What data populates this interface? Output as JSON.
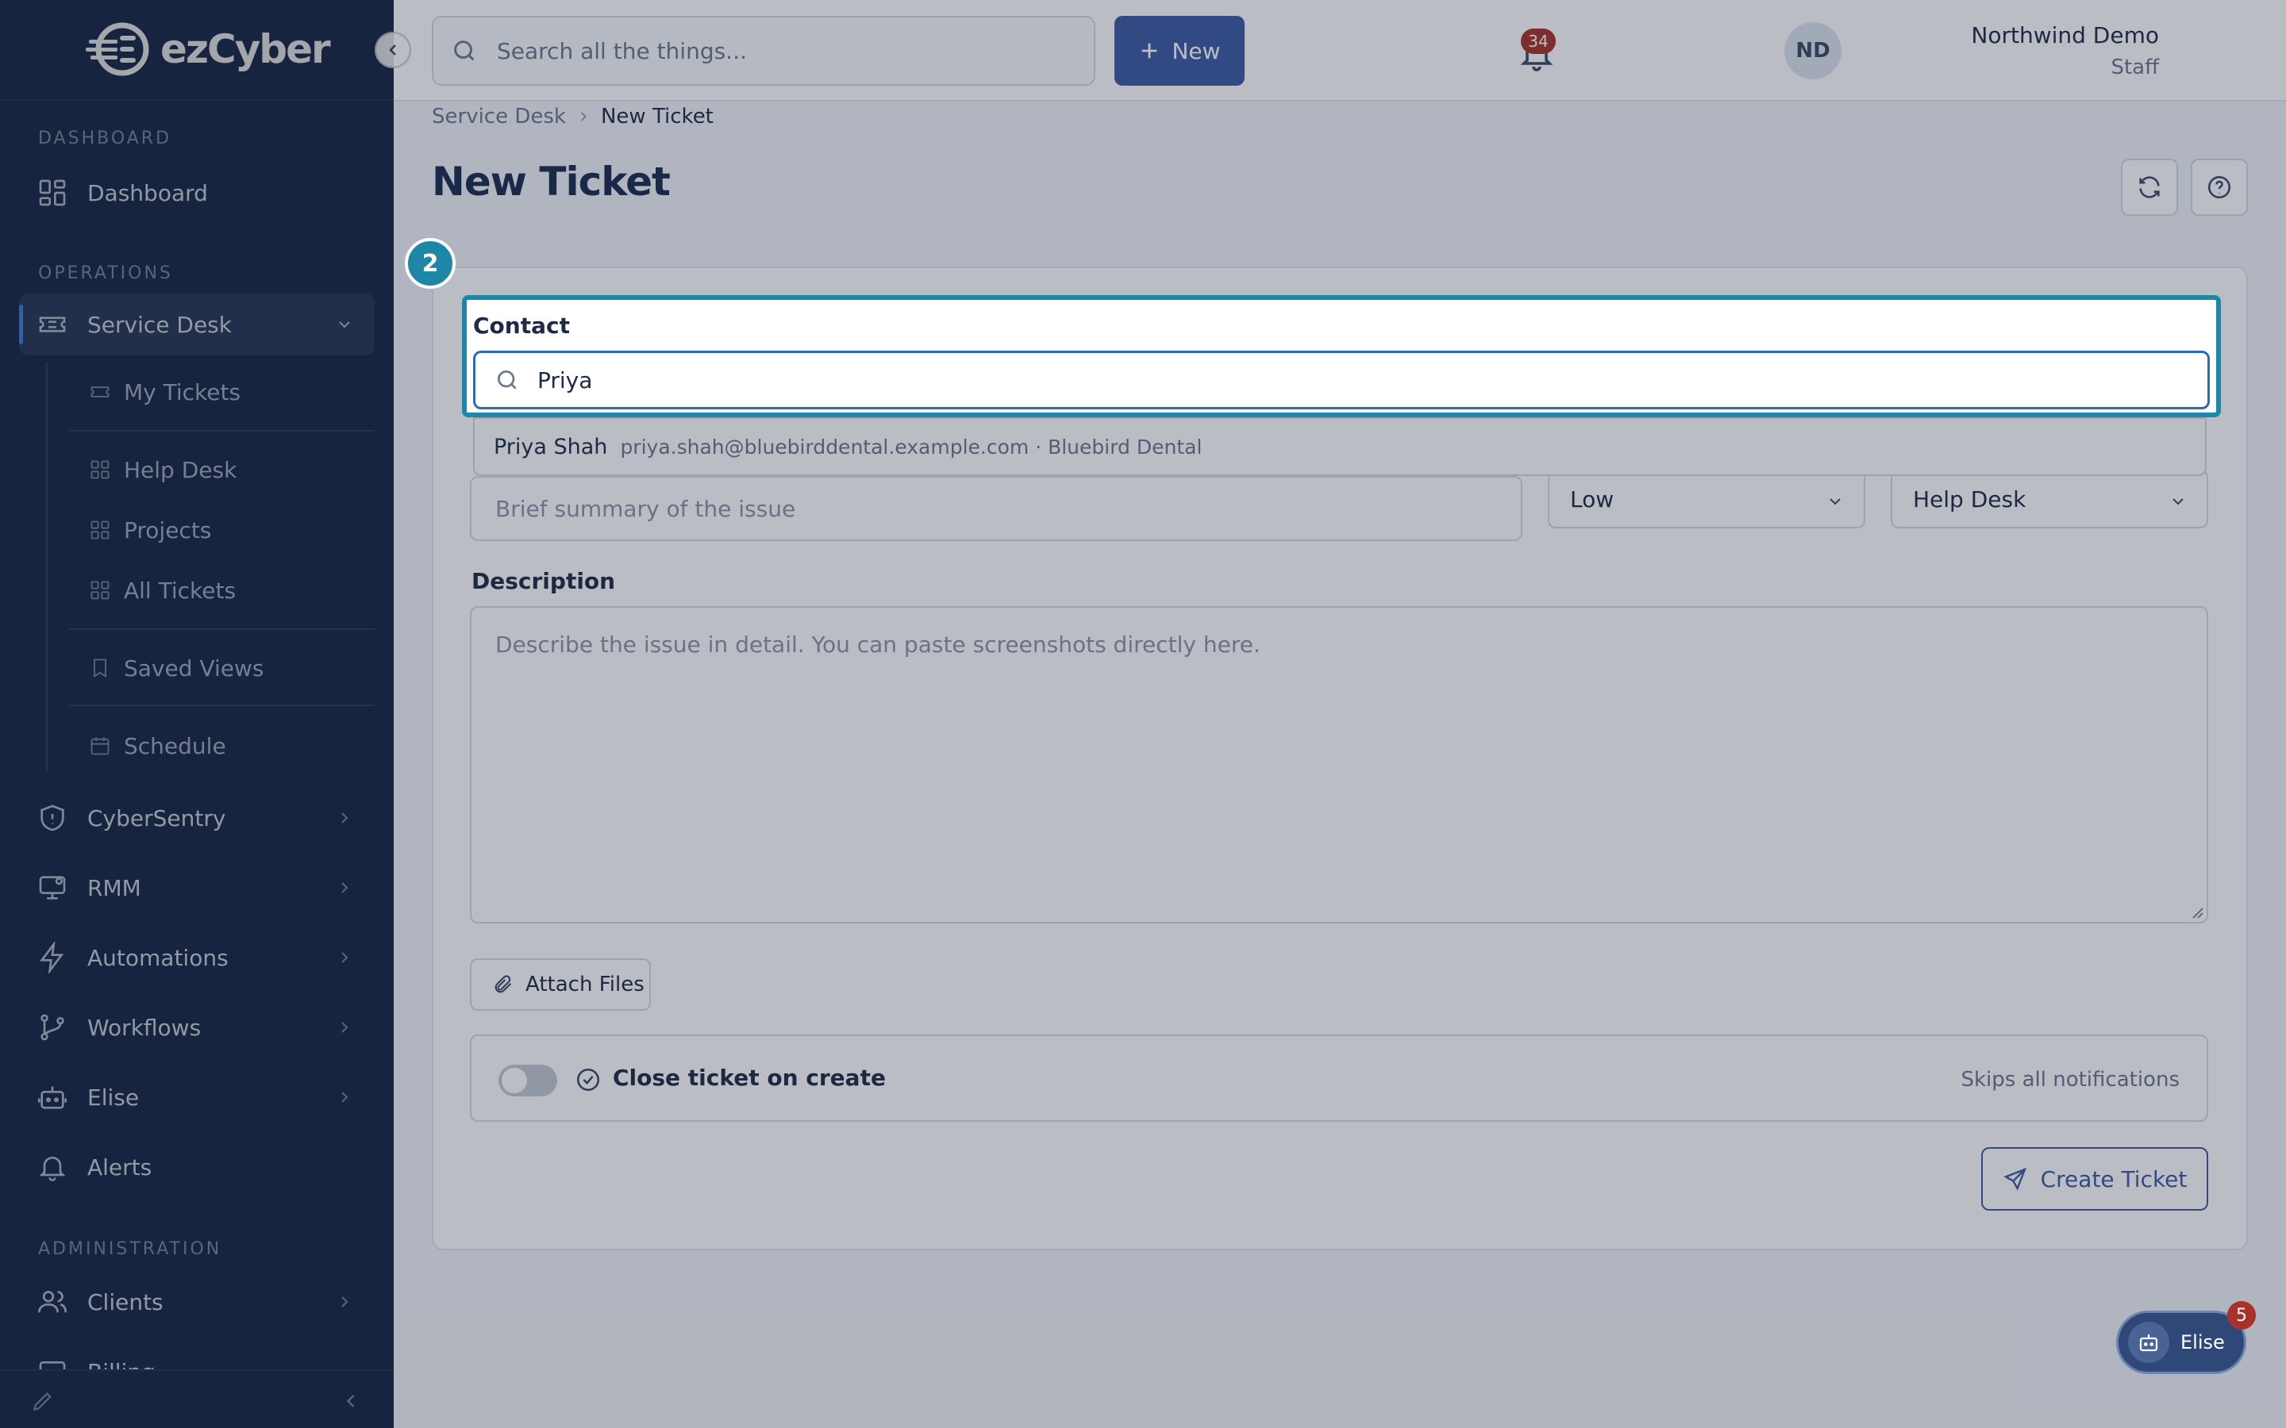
{
  "brand": {
    "name": "ezCyber"
  },
  "colors": {
    "sidebar_bg": "#1b2c4f",
    "accent": "#3b5ba5",
    "highlight": "#1e87a8",
    "badge": "#a8322a"
  },
  "sidebar": {
    "sections": {
      "dashboard": "DASHBOARD",
      "operations": "OPERATIONS",
      "administration": "ADMINISTRATION"
    },
    "items": {
      "dashboard": "Dashboard",
      "service_desk": "Service Desk",
      "cybersentry": "CyberSentry",
      "rmm": "RMM",
      "automations": "Automations",
      "workflows": "Workflows",
      "elise": "Elise",
      "alerts": "Alerts",
      "clients": "Clients",
      "billing": "Billing"
    },
    "sub_items": {
      "my_tickets": "My Tickets",
      "help_desk": "Help Desk",
      "projects": "Projects",
      "all_tickets": "All Tickets",
      "saved_views": "Saved Views",
      "schedule": "Schedule"
    }
  },
  "topbar": {
    "search_placeholder": "Search all the things...",
    "new_label": "New",
    "notifications_count": "34",
    "user_name": "Northwind Demo",
    "user_role": "Staff",
    "avatar_initials": "ND"
  },
  "breadcrumb": {
    "parent": "Service Desk",
    "current": "New Ticket"
  },
  "page": {
    "title": "New Ticket"
  },
  "form": {
    "step_number": "2",
    "contact_label": "Contact",
    "contact_value": "Priya",
    "suggestion": {
      "name": "Priya Shah",
      "meta": "priya.shah@bluebirddental.example.com · Bluebird Dental"
    },
    "subject_placeholder": "Brief summary of the issue",
    "priority_value": "Low",
    "board_value": "Help Desk",
    "description_label": "Description",
    "description_placeholder": "Describe the issue in detail. You can paste screenshots directly here.",
    "attach_label": "Attach Files",
    "close_label": "Close ticket on create",
    "close_note": "Skips all notifications",
    "close_toggle_on": false,
    "submit_label": "Create Ticket"
  },
  "assistant": {
    "label": "Elise",
    "badge_count": "5"
  }
}
